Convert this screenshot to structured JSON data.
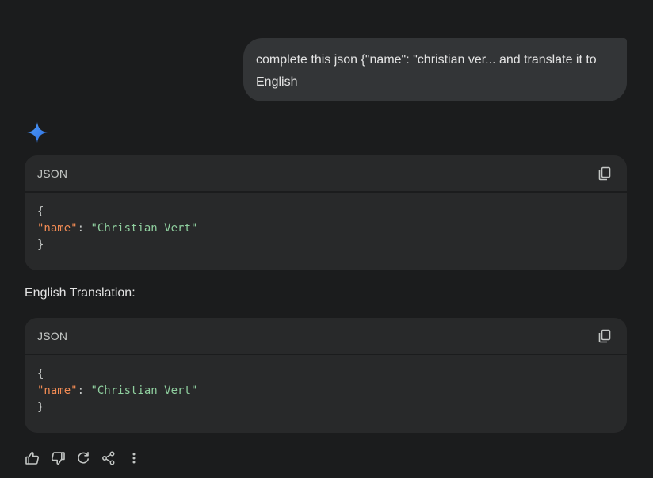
{
  "user_message": {
    "text": "complete this json {\"name\": \"christian ver... and translate it to English"
  },
  "response": {
    "avatar_icon": "gemini-sparkle-icon",
    "code_blocks": [
      {
        "language": "JSON",
        "copy_icon": "copy-icon",
        "lines": {
          "open": "{",
          "key": "\"name\"",
          "sep": ": ",
          "value": "\"Christian Vert\"",
          "close": "}"
        }
      },
      {
        "language": "JSON",
        "copy_icon": "copy-icon",
        "lines": {
          "open": "{",
          "key": "\"name\"",
          "sep": ": ",
          "value": "\"Christian Vert\"",
          "close": "}"
        }
      }
    ],
    "translation_label": "English Translation:"
  },
  "actions": [
    {
      "icon": "thumbs-up-icon"
    },
    {
      "icon": "thumbs-down-icon"
    },
    {
      "icon": "regenerate-icon"
    },
    {
      "icon": "share-icon"
    },
    {
      "icon": "more-vert-icon"
    }
  ],
  "colors": {
    "background": "#1b1c1d",
    "user_bubble": "#333537",
    "code_bg": "#28292a",
    "json_key": "#f28b54",
    "json_string": "#8fcf9f",
    "sparkle_blue": "#4285f4"
  }
}
